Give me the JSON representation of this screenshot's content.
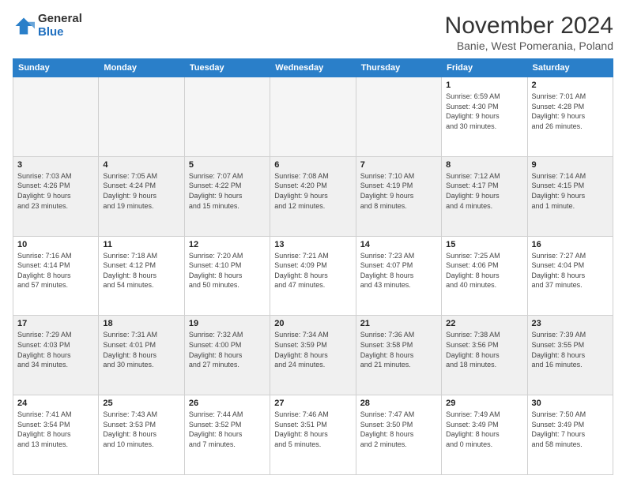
{
  "logo": {
    "general": "General",
    "blue": "Blue"
  },
  "title": "November 2024",
  "subtitle": "Banie, West Pomerania, Poland",
  "headers": [
    "Sunday",
    "Monday",
    "Tuesday",
    "Wednesday",
    "Thursday",
    "Friday",
    "Saturday"
  ],
  "weeks": [
    [
      {
        "day": "",
        "info": "",
        "empty": true
      },
      {
        "day": "",
        "info": "",
        "empty": true
      },
      {
        "day": "",
        "info": "",
        "empty": true
      },
      {
        "day": "",
        "info": "",
        "empty": true
      },
      {
        "day": "",
        "info": "",
        "empty": true
      },
      {
        "day": "1",
        "info": "Sunrise: 6:59 AM\nSunset: 4:30 PM\nDaylight: 9 hours\nand 30 minutes."
      },
      {
        "day": "2",
        "info": "Sunrise: 7:01 AM\nSunset: 4:28 PM\nDaylight: 9 hours\nand 26 minutes."
      }
    ],
    [
      {
        "day": "3",
        "info": "Sunrise: 7:03 AM\nSunset: 4:26 PM\nDaylight: 9 hours\nand 23 minutes."
      },
      {
        "day": "4",
        "info": "Sunrise: 7:05 AM\nSunset: 4:24 PM\nDaylight: 9 hours\nand 19 minutes."
      },
      {
        "day": "5",
        "info": "Sunrise: 7:07 AM\nSunset: 4:22 PM\nDaylight: 9 hours\nand 15 minutes."
      },
      {
        "day": "6",
        "info": "Sunrise: 7:08 AM\nSunset: 4:20 PM\nDaylight: 9 hours\nand 12 minutes."
      },
      {
        "day": "7",
        "info": "Sunrise: 7:10 AM\nSunset: 4:19 PM\nDaylight: 9 hours\nand 8 minutes."
      },
      {
        "day": "8",
        "info": "Sunrise: 7:12 AM\nSunset: 4:17 PM\nDaylight: 9 hours\nand 4 minutes."
      },
      {
        "day": "9",
        "info": "Sunrise: 7:14 AM\nSunset: 4:15 PM\nDaylight: 9 hours\nand 1 minute."
      }
    ],
    [
      {
        "day": "10",
        "info": "Sunrise: 7:16 AM\nSunset: 4:14 PM\nDaylight: 8 hours\nand 57 minutes."
      },
      {
        "day": "11",
        "info": "Sunrise: 7:18 AM\nSunset: 4:12 PM\nDaylight: 8 hours\nand 54 minutes."
      },
      {
        "day": "12",
        "info": "Sunrise: 7:20 AM\nSunset: 4:10 PM\nDaylight: 8 hours\nand 50 minutes."
      },
      {
        "day": "13",
        "info": "Sunrise: 7:21 AM\nSunset: 4:09 PM\nDaylight: 8 hours\nand 47 minutes."
      },
      {
        "day": "14",
        "info": "Sunrise: 7:23 AM\nSunset: 4:07 PM\nDaylight: 8 hours\nand 43 minutes."
      },
      {
        "day": "15",
        "info": "Sunrise: 7:25 AM\nSunset: 4:06 PM\nDaylight: 8 hours\nand 40 minutes."
      },
      {
        "day": "16",
        "info": "Sunrise: 7:27 AM\nSunset: 4:04 PM\nDaylight: 8 hours\nand 37 minutes."
      }
    ],
    [
      {
        "day": "17",
        "info": "Sunrise: 7:29 AM\nSunset: 4:03 PM\nDaylight: 8 hours\nand 34 minutes."
      },
      {
        "day": "18",
        "info": "Sunrise: 7:31 AM\nSunset: 4:01 PM\nDaylight: 8 hours\nand 30 minutes."
      },
      {
        "day": "19",
        "info": "Sunrise: 7:32 AM\nSunset: 4:00 PM\nDaylight: 8 hours\nand 27 minutes."
      },
      {
        "day": "20",
        "info": "Sunrise: 7:34 AM\nSunset: 3:59 PM\nDaylight: 8 hours\nand 24 minutes."
      },
      {
        "day": "21",
        "info": "Sunrise: 7:36 AM\nSunset: 3:58 PM\nDaylight: 8 hours\nand 21 minutes."
      },
      {
        "day": "22",
        "info": "Sunrise: 7:38 AM\nSunset: 3:56 PM\nDaylight: 8 hours\nand 18 minutes."
      },
      {
        "day": "23",
        "info": "Sunrise: 7:39 AM\nSunset: 3:55 PM\nDaylight: 8 hours\nand 16 minutes."
      }
    ],
    [
      {
        "day": "24",
        "info": "Sunrise: 7:41 AM\nSunset: 3:54 PM\nDaylight: 8 hours\nand 13 minutes."
      },
      {
        "day": "25",
        "info": "Sunrise: 7:43 AM\nSunset: 3:53 PM\nDaylight: 8 hours\nand 10 minutes."
      },
      {
        "day": "26",
        "info": "Sunrise: 7:44 AM\nSunset: 3:52 PM\nDaylight: 8 hours\nand 7 minutes."
      },
      {
        "day": "27",
        "info": "Sunrise: 7:46 AM\nSunset: 3:51 PM\nDaylight: 8 hours\nand 5 minutes."
      },
      {
        "day": "28",
        "info": "Sunrise: 7:47 AM\nSunset: 3:50 PM\nDaylight: 8 hours\nand 2 minutes."
      },
      {
        "day": "29",
        "info": "Sunrise: 7:49 AM\nSunset: 3:49 PM\nDaylight: 8 hours\nand 0 minutes."
      },
      {
        "day": "30",
        "info": "Sunrise: 7:50 AM\nSunset: 3:49 PM\nDaylight: 7 hours\nand 58 minutes."
      }
    ]
  ]
}
